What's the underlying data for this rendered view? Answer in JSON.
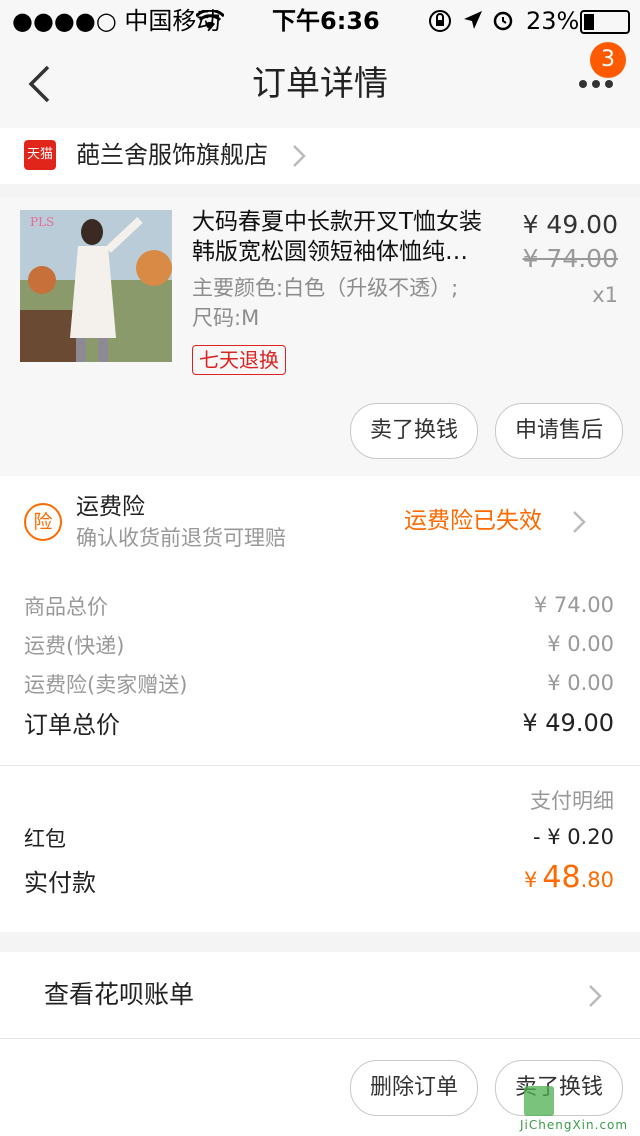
{
  "status_bar": {
    "carrier": "●●●●○ 中国移动",
    "time": "下午6:36",
    "battery": "23%"
  },
  "nav": {
    "title": "订单详情",
    "badge_count": "3"
  },
  "shop": {
    "badge": "天猫",
    "name": "葩兰舍服饰旗舰店"
  },
  "item": {
    "title_line1": "大码春夏中长款开叉T恤女装",
    "title_line2": "韩版宽松圆领短袖体恤纯…",
    "spec_line1": "主要颜色:白色（升级不透）;",
    "spec_line2": "尺码:M",
    "price": "¥ 49.00",
    "original_price": "¥ 74.00",
    "quantity": "x1",
    "return_tag": "七天退换",
    "sell_button": "卖了换钱",
    "aftersale_button": "申请售后"
  },
  "insurance": {
    "icon_text": "险",
    "title": "运费险",
    "subtitle": "确认收货前退货可理赔",
    "status": "运费险已失效"
  },
  "summary": {
    "rows": [
      {
        "label": "商品总价",
        "value": "¥ 74.00"
      },
      {
        "label": "运费(快递)",
        "value": "¥ 0.00"
      },
      {
        "label": "运费险(卖家赠送)",
        "value": "¥ 0.00"
      }
    ],
    "total_label": "订单总价",
    "total_value": "¥ 49.00"
  },
  "payment": {
    "detail_label": "支付明细",
    "redpacket_label": "红包",
    "redpacket_value": "- ¥ 0.20",
    "paid_label": "实付款",
    "paid_currency": "¥",
    "paid_int": "48",
    "paid_dec": ".80"
  },
  "huabei": {
    "label": "查看花呗账单"
  },
  "bottom": {
    "delete_button": "删除订单",
    "sell_button": "卖了换钱",
    "watermark": "JiChengXin.com"
  },
  "colors": {
    "accent": "#ff6a00",
    "tag_red": "#dd2222",
    "tmall_red": "#e1251b"
  }
}
